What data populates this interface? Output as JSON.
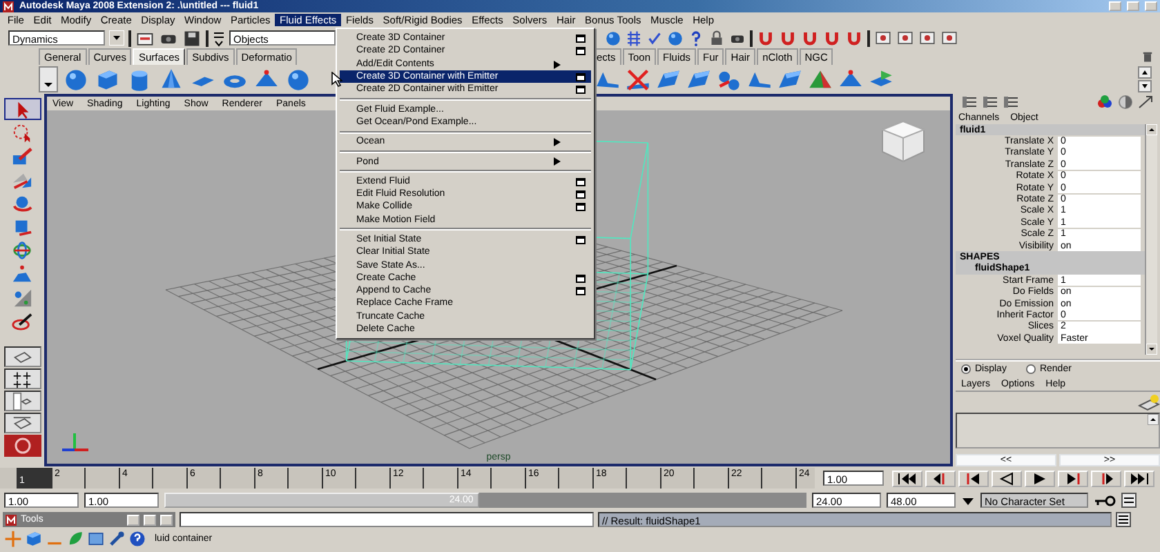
{
  "window": {
    "title": "Autodesk Maya 2008 Extension 2: .\\untitled  ---  fluid1"
  },
  "menubar": [
    {
      "label": "File",
      "selected": false
    },
    {
      "label": "Edit",
      "selected": false
    },
    {
      "label": "Modify",
      "selected": false
    },
    {
      "label": "Create",
      "selected": false
    },
    {
      "label": "Display",
      "selected": false
    },
    {
      "label": "Window",
      "selected": false
    },
    {
      "label": "Particles",
      "selected": false
    },
    {
      "label": "Fluid Effects",
      "selected": true
    },
    {
      "label": "Fields",
      "selected": false
    },
    {
      "label": "Soft/Rigid Bodies",
      "selected": false
    },
    {
      "label": "Effects",
      "selected": false
    },
    {
      "label": "Solvers",
      "selected": false
    },
    {
      "label": "Hair",
      "selected": false
    },
    {
      "label": "Bonus Tools",
      "selected": false
    },
    {
      "label": "Muscle",
      "selected": false
    },
    {
      "label": "Help",
      "selected": false
    }
  ],
  "status_line": {
    "menu_set": "Dynamics",
    "selection_mode": "Objects"
  },
  "shelf_tabs_left": [
    {
      "label": "General",
      "selected": false
    },
    {
      "label": "Curves",
      "selected": false
    },
    {
      "label": "Surfaces",
      "selected": true
    },
    {
      "label": "Subdivs",
      "selected": false
    },
    {
      "label": "Deformatio",
      "selected": false
    }
  ],
  "shelf_tabs_right": [
    {
      "label": "ects",
      "selected": false
    },
    {
      "label": "Toon",
      "selected": false
    },
    {
      "label": "Fluids",
      "selected": false
    },
    {
      "label": "Fur",
      "selected": false
    },
    {
      "label": "Hair",
      "selected": false
    },
    {
      "label": "nCloth",
      "selected": false
    },
    {
      "label": "NGC",
      "selected": false
    }
  ],
  "toolbox": [
    {
      "selected": true
    },
    {
      "selected": false
    },
    {
      "selected": false
    },
    {
      "selected": false
    },
    {
      "selected": false
    },
    {
      "selected": false
    },
    {
      "selected": false
    },
    {
      "selected": false
    },
    {
      "selected": false
    },
    {
      "selected": false
    }
  ],
  "viewport": {
    "menu": [
      "View",
      "Shading",
      "Lighting",
      "Show",
      "Renderer",
      "Panels"
    ],
    "camera": "persp"
  },
  "fluid_menu": [
    {
      "kind": "item",
      "label": "Create 3D Container",
      "option_box": true,
      "submenu": false,
      "selected": false
    },
    {
      "kind": "item",
      "label": "Create 2D Container",
      "option_box": true,
      "submenu": false,
      "selected": false
    },
    {
      "kind": "item",
      "label": "Add/Edit Contents",
      "option_box": false,
      "submenu": true,
      "selected": false
    },
    {
      "kind": "item",
      "label": "Create 3D Container with Emitter",
      "option_box": true,
      "submenu": false,
      "selected": true
    },
    {
      "kind": "item",
      "label": "Create 2D Container with Emitter",
      "option_box": true,
      "submenu": false,
      "selected": false
    },
    {
      "kind": "separator"
    },
    {
      "kind": "item",
      "label": "Get Fluid Example...",
      "option_box": false,
      "submenu": false,
      "selected": false
    },
    {
      "kind": "item",
      "label": "Get Ocean/Pond Example...",
      "option_box": false,
      "submenu": false,
      "selected": false
    },
    {
      "kind": "separator"
    },
    {
      "kind": "item",
      "label": "Ocean",
      "option_box": false,
      "submenu": true,
      "selected": false
    },
    {
      "kind": "separator"
    },
    {
      "kind": "item",
      "label": "Pond",
      "option_box": false,
      "submenu": true,
      "selected": false
    },
    {
      "kind": "separator"
    },
    {
      "kind": "item",
      "label": "Extend Fluid",
      "option_box": true,
      "submenu": false,
      "selected": false
    },
    {
      "kind": "item",
      "label": "Edit Fluid Resolution",
      "option_box": true,
      "submenu": false,
      "selected": false
    },
    {
      "kind": "item",
      "label": "Make Collide",
      "option_box": true,
      "submenu": false,
      "selected": false
    },
    {
      "kind": "item",
      "label": "Make Motion Field",
      "option_box": false,
      "submenu": false,
      "selected": false
    },
    {
      "kind": "separator"
    },
    {
      "kind": "item",
      "label": "Set Initial State",
      "option_box": true,
      "submenu": false,
      "selected": false
    },
    {
      "kind": "item",
      "label": "Clear Initial State",
      "option_box": false,
      "submenu": false,
      "selected": false
    },
    {
      "kind": "item",
      "label": "Save State As...",
      "option_box": false,
      "submenu": false,
      "selected": false
    },
    {
      "kind": "item",
      "label": "Create Cache",
      "option_box": true,
      "submenu": false,
      "selected": false
    },
    {
      "kind": "item",
      "label": "Append to Cache",
      "option_box": true,
      "submenu": false,
      "selected": false
    },
    {
      "kind": "item",
      "label": "Replace Cache Frame",
      "option_box": false,
      "submenu": false,
      "selected": false
    },
    {
      "kind": "item",
      "label": "Truncate Cache",
      "option_box": false,
      "submenu": false,
      "selected": false
    },
    {
      "kind": "item",
      "label": "Delete Cache",
      "option_box": false,
      "submenu": false,
      "selected": false
    }
  ],
  "channel_box": {
    "menu": [
      "Channels",
      "Object"
    ],
    "node": "fluid1",
    "attributes": [
      {
        "name": "Translate X",
        "value": "0"
      },
      {
        "name": "Translate Y",
        "value": "0"
      },
      {
        "name": "Translate Z",
        "value": "0"
      },
      {
        "name": "Rotate X",
        "value": "0"
      },
      {
        "name": "Rotate Y",
        "value": "0"
      },
      {
        "name": "Rotate Z",
        "value": "0"
      },
      {
        "name": "Scale X",
        "value": "1"
      },
      {
        "name": "Scale Y",
        "value": "1"
      },
      {
        "name": "Scale Z",
        "value": "1"
      },
      {
        "name": "Visibility",
        "value": "on"
      }
    ],
    "shapes_heading": "SHAPES",
    "shape_node": "fluidShape1",
    "shape_attributes": [
      {
        "name": "Start Frame",
        "value": "1"
      },
      {
        "name": "Do Fields",
        "value": "on"
      },
      {
        "name": "Do Emission",
        "value": "on"
      },
      {
        "name": "Inherit Factor",
        "value": "0"
      },
      {
        "name": "Slices",
        "value": "2"
      },
      {
        "name": "Voxel Quality",
        "value": "Faster"
      }
    ]
  },
  "layer_editor": {
    "modes": [
      {
        "label": "Display",
        "selected": true
      },
      {
        "label": "Render",
        "selected": false
      }
    ],
    "menu": [
      "Layers",
      "Options",
      "Help"
    ]
  },
  "panel_scroll": [
    "<<",
    ">>"
  ],
  "time_slider": {
    "level": 0,
    "current_frame": "1",
    "labels": [
      "2",
      "4",
      "6",
      "8",
      "10",
      "12",
      "14",
      "16",
      "18",
      "20",
      "22",
      "24"
    ],
    "current_time": "1.00"
  },
  "range_slider": {
    "level": 0.49,
    "start_time": "1.00",
    "playback_start": "1.00",
    "range_label": "24.00",
    "playback_end": "24.00",
    "end_time": "48.00",
    "character_set": "No Character Set"
  },
  "command_line": {
    "window_title": "Tools",
    "result": "// Result: fluidShape1"
  },
  "help_line": "luid container"
}
